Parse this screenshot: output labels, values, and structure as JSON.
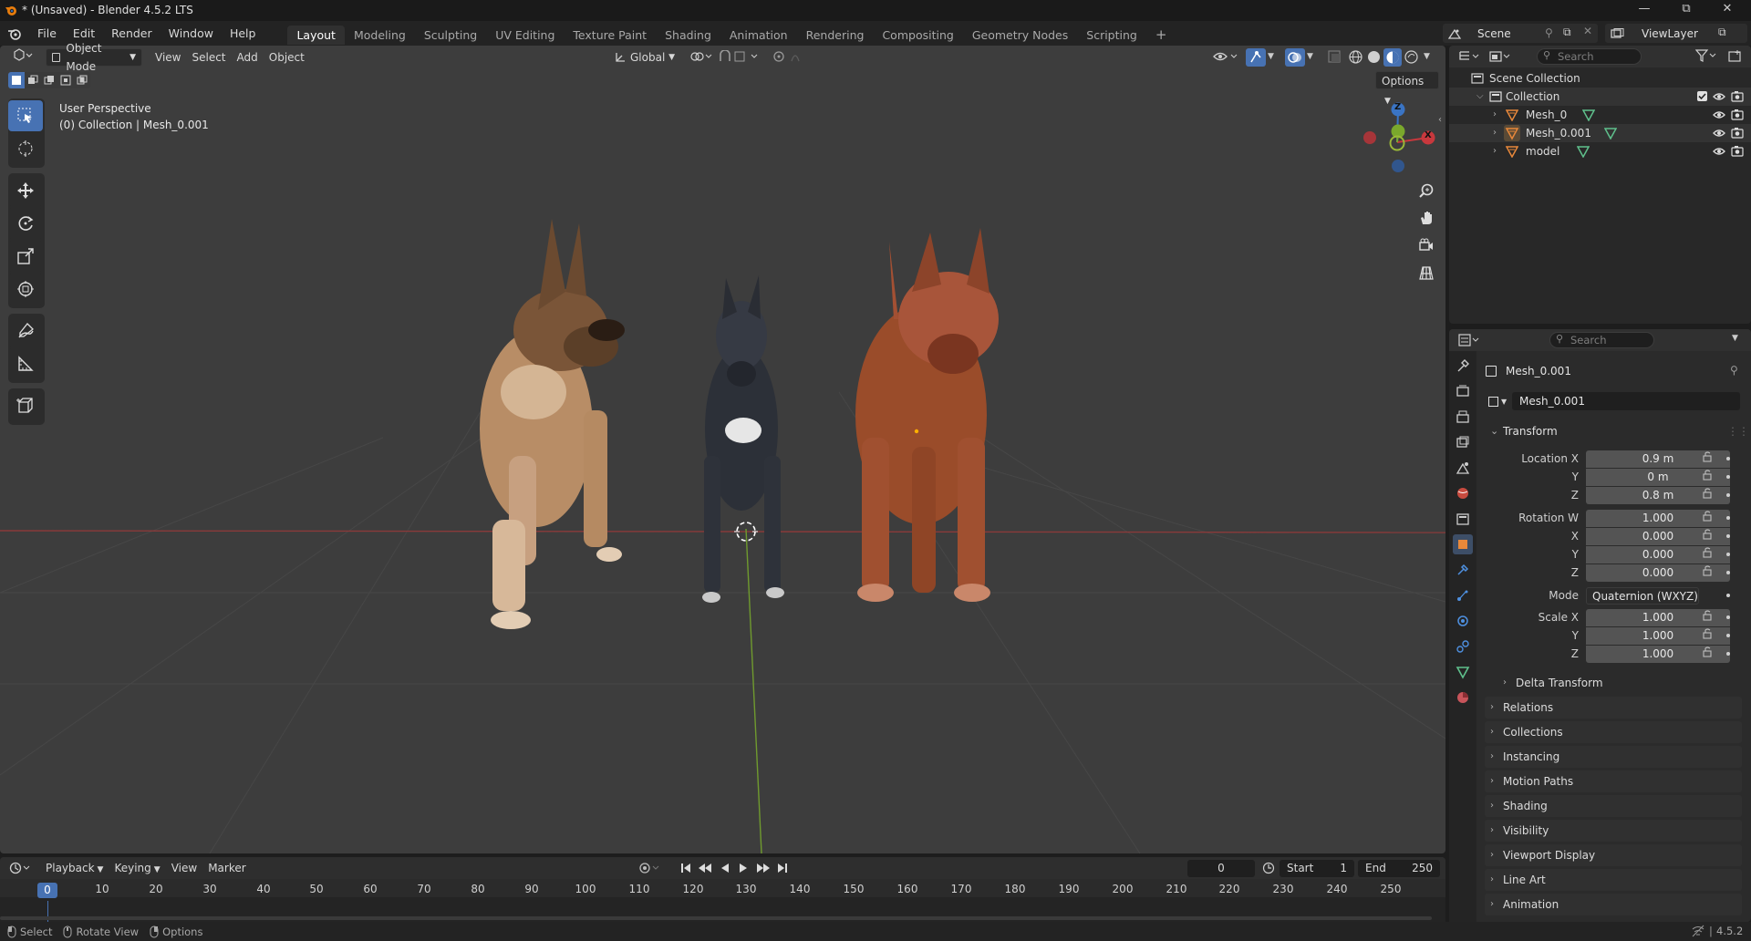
{
  "window": {
    "title": "* (Unsaved) - Blender 4.5.2 LTS"
  },
  "menu": [
    "File",
    "Edit",
    "Render",
    "Window",
    "Help"
  ],
  "workspaces": [
    "Layout",
    "Modeling",
    "Sculpting",
    "UV Editing",
    "Texture Paint",
    "Shading",
    "Animation",
    "Rendering",
    "Compositing",
    "Geometry Nodes",
    "Scripting"
  ],
  "active_workspace": "Layout",
  "scene": {
    "name": "Scene",
    "view_layer": "ViewLayer"
  },
  "viewport": {
    "mode": "Object Mode",
    "menus": [
      "View",
      "Select",
      "Add",
      "Object"
    ],
    "transform_orientation": "Global",
    "options_label": "Options",
    "info_line1": "User Perspective",
    "info_line2": "(0) Collection | Mesh_0.001",
    "axes": {
      "x": "X",
      "y": "Y",
      "z": "Z"
    }
  },
  "outliner": {
    "search_placeholder": "Search",
    "root": "Scene Collection",
    "collection": "Collection",
    "items": [
      {
        "name": "Mesh_0"
      },
      {
        "name": "Mesh_0.001"
      },
      {
        "name": "model"
      }
    ]
  },
  "properties": {
    "search_placeholder": "Search",
    "object_name": "Mesh_0.001",
    "object_field": "Mesh_0.001",
    "transform_title": "Transform",
    "location": {
      "label": "Location X",
      "x": "0.9 m",
      "y": "0 m",
      "z": "0.8 m"
    },
    "rotation": {
      "label": "Rotation W",
      "w": "1.000",
      "x": "0.000",
      "y": "0.000",
      "z": "0.000"
    },
    "axis_labels": {
      "x": "X",
      "y": "Y",
      "z": "Z"
    },
    "mode_label": "Mode",
    "mode_value": "Quaternion (WXYZ)",
    "scale": {
      "label": "Scale X",
      "x": "1.000",
      "y": "1.000",
      "z": "1.000"
    },
    "delta_transform": "Delta Transform",
    "panels": [
      "Relations",
      "Collections",
      "Instancing",
      "Motion Paths",
      "Shading",
      "Visibility",
      "Viewport Display",
      "Line Art",
      "Animation"
    ]
  },
  "timeline": {
    "menus": [
      "Playback",
      "Keying",
      "View",
      "Marker"
    ],
    "current_frame": "0",
    "start_label": "Start",
    "start": "1",
    "end_label": "End",
    "end": "250",
    "ruler": [
      "0",
      "10",
      "20",
      "30",
      "40",
      "50",
      "60",
      "70",
      "80",
      "90",
      "100",
      "110",
      "120",
      "130",
      "140",
      "150",
      "160",
      "170",
      "180",
      "190",
      "200",
      "210",
      "220",
      "230",
      "240",
      "250"
    ]
  },
  "status": {
    "select": "Select",
    "rotate": "Rotate View",
    "options": "Options",
    "version": "4.5.2"
  },
  "colors": {
    "accent": "#4772b3",
    "x_axis": "#c8383d",
    "y_axis": "#7aa82c",
    "z_axis": "#3a74c4",
    "orange_object": "#e8883a"
  }
}
